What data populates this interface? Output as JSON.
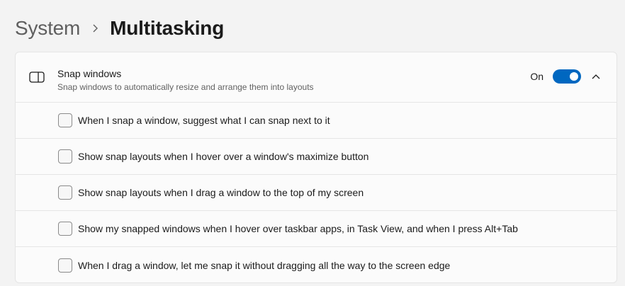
{
  "breadcrumb": {
    "parent": "System",
    "separator_icon": "chevron-right-icon",
    "current": "Multitasking"
  },
  "snap_windows": {
    "icon": "snap-window-icon",
    "title": "Snap windows",
    "description": "Snap windows to automatically resize and arrange them into layouts",
    "toggle_state_label": "On",
    "toggle_on": true,
    "expand_icon": "chevron-up-icon",
    "accent_color": "#0067c0",
    "options": [
      {
        "label": "When I snap a window, suggest what I can snap next to it",
        "checked": false
      },
      {
        "label": "Show snap layouts when I hover over a window's maximize button",
        "checked": false
      },
      {
        "label": "Show snap layouts when I drag a window to the top of my screen",
        "checked": false
      },
      {
        "label": "Show my snapped windows when I hover over taskbar apps, in Task View, and when I press Alt+Tab",
        "checked": false
      },
      {
        "label": "When I drag a window, let me snap it without dragging all the way to the screen edge",
        "checked": false
      }
    ]
  }
}
